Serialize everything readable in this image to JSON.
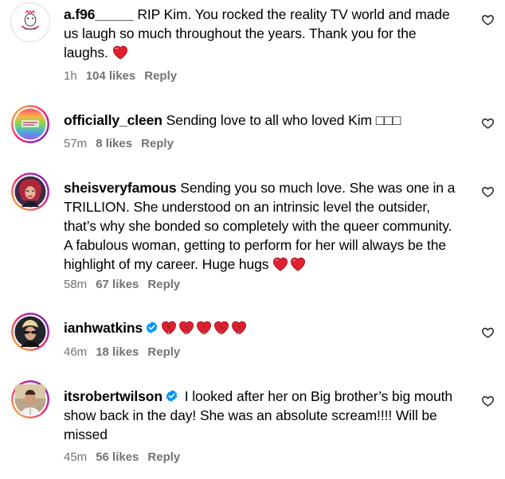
{
  "comments": [
    {
      "username": "a.f96_____",
      "text": " RIP Kim. You rocked the reality TV world and made us laugh so much throughout the years. Thank you for the laughs.",
      "emoji": "red-heart",
      "time": "1h",
      "likes": "104 likes",
      "reply": "Reply",
      "verified": false
    },
    {
      "username": "officially_cleen",
      "text": " Sending love to all who loved Kim □□□",
      "time": "57m",
      "likes": "8 likes",
      "reply": "Reply",
      "verified": false
    },
    {
      "username": "sheisveryfamous",
      "text": " Sending you so much love. She was one in a TRILLION. She understood on an intrinsic level the outsider, that’s why she bonded so completely with the queer community. A fabulous woman, getting to perform for her will always be the highlight of my career. Huge hugs ",
      "emoji": "two red hearts",
      "time": "58m",
      "likes": "67 likes",
      "reply": "Reply",
      "verified": false
    },
    {
      "username": "ianhwatkins",
      "text": "",
      "emoji": "five broken hearts",
      "time": "46m",
      "likes": "18 likes",
      "reply": "Reply",
      "verified": true
    },
    {
      "username": "itsrobertwilson",
      "text": " I looked after her on Big brother’s big mouth show back in the day! She was an absolute scream!!!! Will be missed",
      "time": "45m",
      "likes": "56 likes",
      "reply": "Reply",
      "verified": true
    }
  ],
  "icons": {
    "like": "heart-outline-icon",
    "verified": "verified-badge-icon"
  },
  "colors": {
    "meta": "#737373",
    "verified": "#0095f6",
    "heart": "#e0202f"
  }
}
